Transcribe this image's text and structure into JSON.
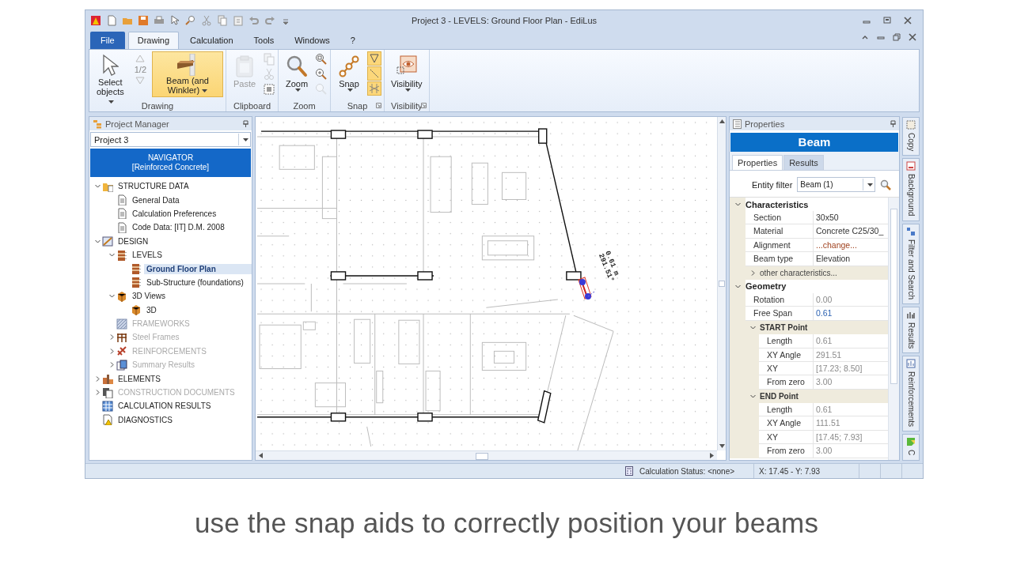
{
  "window": {
    "title": "Project 3 -  LEVELS: Ground Floor Plan - EdiLus"
  },
  "ribbon": {
    "tabs": [
      {
        "label": "File",
        "kind": "file",
        "selected": false
      },
      {
        "label": "Drawing",
        "kind": "tab",
        "selected": true
      },
      {
        "label": "Calculation",
        "kind": "tab",
        "selected": false
      },
      {
        "label": "Tools",
        "kind": "tab",
        "selected": false
      },
      {
        "label": "Windows",
        "kind": "tab",
        "selected": false
      },
      {
        "label": "?",
        "kind": "tab",
        "selected": false
      }
    ],
    "groups": [
      {
        "label": "Drawing",
        "kind": "drawing",
        "buttons": [
          {
            "lines": [
              "Select",
              "objects"
            ],
            "kind": "select",
            "selected": false,
            "disabled": false,
            "menu": true
          },
          {
            "lines": [
              "Beam (and",
              "Winkler)"
            ],
            "kind": "beam",
            "selected": true,
            "disabled": false,
            "menu": true
          }
        ],
        "pager": "1/2",
        "launcher": false
      },
      {
        "label": "Clipboard",
        "kind": "clipboard",
        "buttons": [
          {
            "lines": [
              "Paste"
            ],
            "kind": "paste",
            "selected": false,
            "disabled": true,
            "menu": false
          }
        ],
        "launcher": false
      },
      {
        "label": "Zoom",
        "kind": "zoom",
        "buttons": [
          {
            "lines": [
              "Zoom"
            ],
            "kind": "zoom",
            "selected": false,
            "disabled": false,
            "menu": true
          }
        ],
        "launcher": false
      },
      {
        "label": "Snap",
        "kind": "snap",
        "buttons": [
          {
            "lines": [
              "Snap"
            ],
            "kind": "snap",
            "selected": false,
            "disabled": false,
            "menu": true
          }
        ],
        "toggles": [
          {
            "on": true
          },
          {
            "on": true
          },
          {
            "on": true
          }
        ],
        "launcher": true
      },
      {
        "label": "Visibility",
        "kind": "visibility",
        "buttons": [
          {
            "lines": [
              "Visibility"
            ],
            "kind": "visibility",
            "selected": false,
            "disabled": false,
            "menu": true
          }
        ],
        "launcher": true
      }
    ]
  },
  "project_manager": {
    "title": "Project Manager",
    "project": "Project 3",
    "navigator": [
      "NAVIGATOR",
      "[Reinforced Concrete]"
    ],
    "tree": [
      {
        "label": "STRUCTURE DATA",
        "kind": "folder",
        "expanded": true,
        "selected": false,
        "disabled": false,
        "children": [
          {
            "label": "General Data",
            "kind": "doc",
            "selected": false,
            "disabled": false
          },
          {
            "label": "Calculation Preferences",
            "kind": "doc",
            "selected": false,
            "disabled": false
          },
          {
            "label": "Code Data: [IT] D.M. 2008",
            "kind": "doc",
            "selected": false,
            "disabled": false
          }
        ]
      },
      {
        "label": "DESIGN",
        "kind": "design",
        "expanded": true,
        "selected": false,
        "disabled": false,
        "children": [
          {
            "label": "LEVELS",
            "kind": "levels",
            "expanded": true,
            "selected": false,
            "disabled": false,
            "children": [
              {
                "label": "Ground Floor Plan",
                "kind": "levels",
                "selected": true,
                "disabled": false
              },
              {
                "label": "Sub-Structure (foundations)",
                "kind": "levels",
                "selected": false,
                "disabled": false
              }
            ]
          },
          {
            "label": "3D Views",
            "kind": "cube",
            "expanded": true,
            "selected": false,
            "disabled": false,
            "children": [
              {
                "label": "3D",
                "kind": "cube",
                "selected": false,
                "disabled": false
              }
            ]
          },
          {
            "label": "FRAMEWORKS",
            "kind": "hatch",
            "selected": false,
            "disabled": true
          },
          {
            "label": "Steel Frames",
            "kind": "frame",
            "expanded": false,
            "selected": false,
            "disabled": true
          },
          {
            "label": "REINFORCEMENTS",
            "kind": "rebar",
            "expanded": false,
            "selected": false,
            "disabled": true
          },
          {
            "label": "Summary Results",
            "kind": "report",
            "expanded": false,
            "selected": false,
            "disabled": true
          }
        ]
      },
      {
        "label": "ELEMENTS",
        "kind": "elements",
        "expanded": false,
        "selected": false,
        "disabled": false
      },
      {
        "label": "CONSTRUCTION DOCUMENTS",
        "kind": "documents",
        "expanded": false,
        "selected": false,
        "disabled": true
      },
      {
        "label": "CALCULATION RESULTS",
        "kind": "table",
        "selected": false,
        "disabled": false
      },
      {
        "label": "DIAGNOSTICS",
        "kind": "warning",
        "selected": false,
        "disabled": false
      }
    ]
  },
  "canvas": {
    "dimension_labels": [
      "0.61 m",
      "291.51°"
    ]
  },
  "properties": {
    "title": "Properties",
    "header": "Beam",
    "tabs": [
      {
        "label": "Properties",
        "selected": true
      },
      {
        "label": "Results",
        "selected": false
      }
    ],
    "entity_filter": {
      "label": "Entity filter",
      "value": "Beam (1)"
    },
    "sections": [
      {
        "title": "Characteristics",
        "expanded": true,
        "rows": [
          {
            "label": "Section",
            "value": "30x50",
            "kind": "text"
          },
          {
            "label": "Material",
            "value": "Concrete C25/30_",
            "kind": "text"
          },
          {
            "label": "Alignment",
            "value": "...change...",
            "kind": "action"
          },
          {
            "label": "Beam type",
            "value": "Elevation",
            "kind": "text"
          }
        ],
        "subsections": [
          {
            "title": "other characteristics...",
            "expanded": false,
            "kind": "more"
          }
        ]
      },
      {
        "title": "Geometry",
        "expanded": true,
        "rows": [
          {
            "label": "Rotation",
            "value": "0.00",
            "kind": "readonly"
          },
          {
            "label": "Free Span",
            "value": "0.61",
            "kind": "computed"
          }
        ],
        "subsections": [
          {
            "title": "START Point",
            "expanded": true,
            "kind": "group",
            "rows": [
              {
                "label": "Length",
                "value": "0.61",
                "kind": "readonly"
              },
              {
                "label": "XY Angle",
                "value": "291.51",
                "kind": "readonly"
              },
              {
                "label": "XY",
                "value": "[17.23; 8.50]",
                "kind": "readonly"
              },
              {
                "label": "From zero",
                "value": "3.00",
                "kind": "readonly"
              }
            ]
          },
          {
            "title": "END Point",
            "expanded": true,
            "kind": "group",
            "rows": [
              {
                "label": "Length",
                "value": "0.61",
                "kind": "readonly"
              },
              {
                "label": "XY Angle",
                "value": "111.51",
                "kind": "readonly"
              },
              {
                "label": "XY",
                "value": "[17.45; 7.93]",
                "kind": "readonly"
              },
              {
                "label": "From zero",
                "value": "3.00",
                "kind": "readonly"
              }
            ]
          }
        ]
      }
    ]
  },
  "side_tabs": [
    {
      "label": "Copy",
      "kind": "copy"
    },
    {
      "label": "Background",
      "kind": "background"
    },
    {
      "label": "Filter and Search",
      "kind": "filter"
    },
    {
      "label": "Results",
      "kind": "results"
    },
    {
      "label": "Reinforcements",
      "kind": "reinforcements"
    },
    {
      "label": "C",
      "kind": "checks"
    }
  ],
  "status_bar": {
    "calculation_status": "Calculation Status: <none>",
    "coordinates": "X: 17.45 - Y: 7.93"
  },
  "caption": "use the snap aids to correctly position your beams"
}
